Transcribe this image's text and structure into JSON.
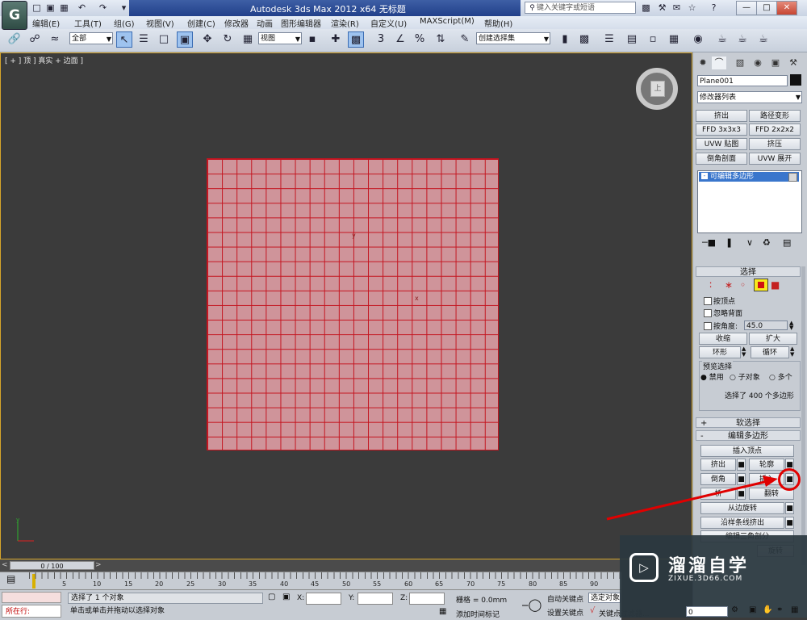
{
  "app": {
    "logo_letter": "G",
    "title": "Autodesk 3ds Max  2012 x64      无标题",
    "search_placeholder": "键入关键字或短语",
    "window_buttons": [
      "—",
      "□",
      "✕"
    ]
  },
  "quick_access": [
    "☐",
    "↶",
    "↷",
    "▾"
  ],
  "menu": [
    "编辑(E)",
    "工具(T)",
    "组(G)",
    "视图(V)",
    "创建(C)",
    "修改器",
    "动画",
    "图形编辑器",
    "渲染(R)",
    "自定义(U)",
    "MAXScript(M)",
    "帮助(H)"
  ],
  "toolbar": {
    "filter": "全部",
    "ref_coord": "视图",
    "named_selection": "创建选择集",
    "snaps": [
      "3",
      "∠",
      "%"
    ]
  },
  "viewport": {
    "label": "[ + ] 顶 ] 真实 + 边面 ]",
    "viewcube_label": "上",
    "axis_y": "y",
    "axis_x": "x"
  },
  "command_panel": {
    "object_name": "Plane001",
    "modifier_list": "修改器列表",
    "modifier_buttons": [
      [
        "挤出",
        "路径变形"
      ],
      [
        "FFD 3x3x3",
        "FFD 2x2x2"
      ],
      [
        "UVW 贴图",
        "挤压"
      ],
      [
        "倒角剖面",
        "UVW 展开"
      ]
    ],
    "stack_item": "可编辑多边形",
    "selection": {
      "header": "选择",
      "by_vertex": "按顶点",
      "ignore_backfacing": "忽略背面",
      "by_angle": "按角度:",
      "angle_value": "45.0",
      "shrink": "收缩",
      "grow": "扩大",
      "ring": "环形",
      "loop": "循环",
      "preview_label": "预览选择",
      "preview_options": [
        "禁用",
        "子对象",
        "多个"
      ],
      "status": "选择了 400 个多边形"
    },
    "soft_selection": "软选择",
    "edit_polygons": {
      "header": "编辑多边形",
      "insert_vertex": "插入顶点",
      "extrude": "挤出",
      "outline": "轮廓",
      "bevel": "倒角",
      "inset": "插入",
      "bridge": "桥",
      "flip": "翻转",
      "hinge": "从边旋转",
      "extrude_spline": "沿样条线挤出",
      "edit_tri": "编辑三角剖分",
      "turn": "旋转"
    }
  },
  "watermark": {
    "title": "溜溜自学",
    "url": "ZIXUE.3D66.COM"
  },
  "timeline": {
    "slider": "0 / 100",
    "ticks": [
      "5",
      "10",
      "15",
      "20",
      "25",
      "30",
      "35",
      "40",
      "45",
      "50",
      "55",
      "60",
      "65",
      "70",
      "75",
      "80",
      "85",
      "90"
    ]
  },
  "status": {
    "running": "所在行:",
    "selected": "选择了 1 个对象",
    "prompt": "单击或单击并拖动以选择对象",
    "x_label": "X:",
    "y_label": "Y:",
    "z_label": "Z:",
    "grid": "栅格 = 0.0mm",
    "add_time_tag": "添加时间标记",
    "auto_key": "自动关键点",
    "set_key": "设置关键点",
    "selected_set": "选定对象",
    "key_filters": "关键点过滤器...",
    "frame": "0"
  },
  "colors": {
    "plane_fill": "#cf949a",
    "plane_wire": "#c4141f",
    "viewport_bg": "#3b3b3b",
    "annotation": "#e00000"
  }
}
